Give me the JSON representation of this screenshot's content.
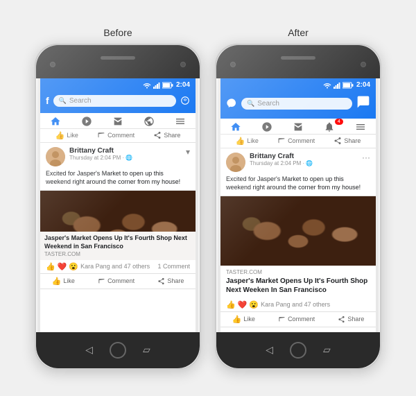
{
  "labels": {
    "before": "Before",
    "after": "After"
  },
  "phone": {
    "status_time": "2:04",
    "search_placeholder": "Search",
    "post": {
      "username": "Brittany Craft",
      "meta": "Thursday at 2:04 PM · 🌐",
      "text": "Excited for Jasper's Market to open up this weekend right around the corner from my house!",
      "link_source": "TASTER.COM",
      "link_title_before": "Jasper's Market Opens Up It's Fourth Shop Next Weekend in San Francisco",
      "link_title_after": "Jasper's Market Opens Up It's Fourth Shop Next Weeken In San Francisco",
      "reactions": "Kara Pang and 47 others",
      "comments": "1 Comment",
      "like_label": "Like",
      "comment_label": "Comment",
      "share_label": "Share"
    },
    "nav": {
      "home": "Home",
      "watch": "Watch",
      "marketplace": "Marketplace",
      "notifications": "Notifications",
      "notification_badge": "4",
      "menu": "Menu"
    }
  }
}
